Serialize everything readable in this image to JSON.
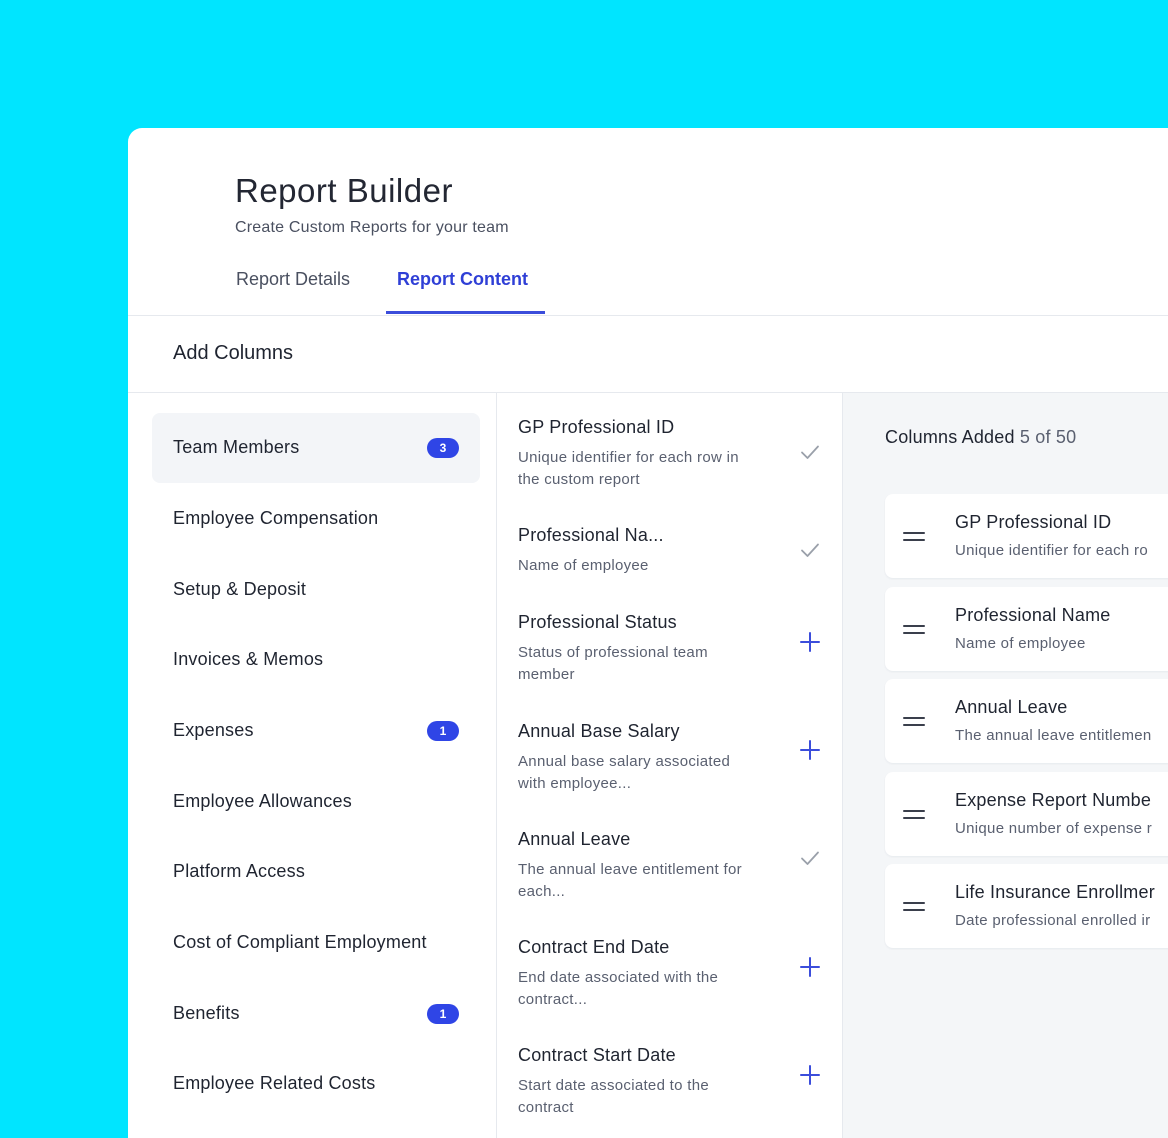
{
  "colors": {
    "background": "#00e5ff",
    "accent": "#3b4ddb",
    "badge": "#2f45e6",
    "check": "#9aa0aa",
    "plus": "#3b4ddb"
  },
  "header": {
    "title": "Report Builder",
    "subtitle": "Create Custom Reports for your team",
    "tabs": [
      {
        "label": "Report Details",
        "active": false
      },
      {
        "label": "Report Content",
        "active": true
      }
    ]
  },
  "add_columns": {
    "title": "Add Columns"
  },
  "categories": [
    {
      "label": "Team Members",
      "badge": "3",
      "active": true
    },
    {
      "label": "Employee Compensation",
      "badge": ""
    },
    {
      "label": "Setup & Deposit",
      "badge": ""
    },
    {
      "label": "Invoices & Memos",
      "badge": ""
    },
    {
      "label": "Expenses",
      "badge": "1"
    },
    {
      "label": "Employee Allowances",
      "badge": ""
    },
    {
      "label": "Platform Access",
      "badge": ""
    },
    {
      "label": "Cost of Compliant Employment",
      "badge": ""
    },
    {
      "label": "Benefits",
      "badge": "1"
    },
    {
      "label": "Employee Related Costs",
      "badge": ""
    }
  ],
  "fields": [
    {
      "name": "GP Professional ID",
      "desc": "Unique identifier for each row in the custom report",
      "state": "check-icon"
    },
    {
      "name": "Professional Na...",
      "desc": "Name of employee",
      "state": "check-icon"
    },
    {
      "name": "Professional Status",
      "desc": "Status of professional team member",
      "state": "plus-icon"
    },
    {
      "name": "Annual Base Salary",
      "desc": "Annual base salary associated with employee...",
      "state": "plus-icon"
    },
    {
      "name": "Annual Leave",
      "desc": "The annual leave entitlement for each...",
      "state": "check-icon"
    },
    {
      "name": "Contract End Date",
      "desc": "End date associated with the contract...",
      "state": "plus-icon"
    },
    {
      "name": "Contract Start Date",
      "desc": "Start date associated to the contract",
      "state": "plus-icon"
    }
  ],
  "columns_added": {
    "label": "Columns Added",
    "count": "5 of 50",
    "items": [
      {
        "name": "GP Professional ID",
        "desc": "Unique identifier for each ro"
      },
      {
        "name": "Professional Name",
        "desc": "Name of employee"
      },
      {
        "name": "Annual Leave",
        "desc": "The annual leave entitlemen"
      },
      {
        "name": "Expense Report Numbe",
        "desc": "Unique number of expense r"
      },
      {
        "name": "Life Insurance Enrollmer",
        "desc": "Date professional enrolled ir"
      }
    ]
  }
}
